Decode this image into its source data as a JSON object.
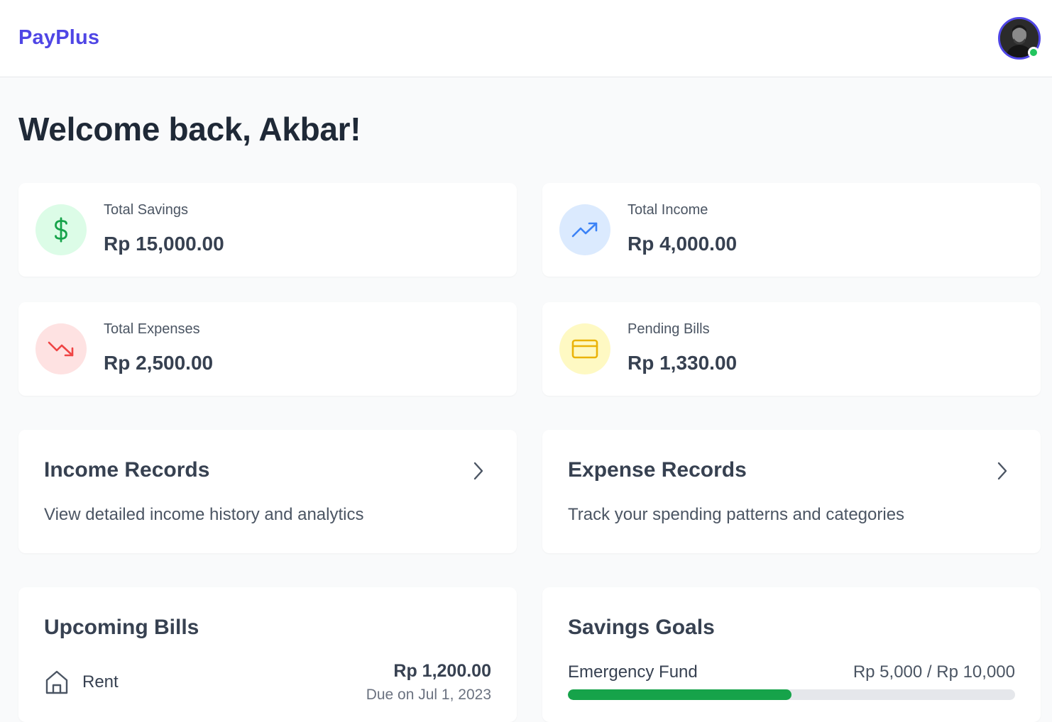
{
  "header": {
    "brand": "PayPlus",
    "user_status": "online"
  },
  "welcome": "Welcome back, Akbar!",
  "stats": [
    {
      "label": "Total Savings",
      "value": "Rp 15,000.00",
      "icon": "dollar-icon",
      "color": "#16a34a",
      "bg": "#dcfce7"
    },
    {
      "label": "Total Income",
      "value": "Rp 4,000.00",
      "icon": "trending-up-icon",
      "color": "#3b82f6",
      "bg": "#dbeafe"
    },
    {
      "label": "Total Expenses",
      "value": "Rp 2,500.00",
      "icon": "trending-down-icon",
      "color": "#ef4444",
      "bg": "#fee2e2"
    },
    {
      "label": "Pending Bills",
      "value": "Rp 1,330.00",
      "icon": "credit-card-icon",
      "color": "#eab308",
      "bg": "#fef9c3"
    }
  ],
  "records": [
    {
      "title": "Income Records",
      "description": "View detailed income history and analytics",
      "icon": "chevron-right-icon"
    },
    {
      "title": "Expense Records",
      "description": "Track your spending patterns and categories",
      "icon": "chevron-right-icon"
    }
  ],
  "upcoming_bills": {
    "title": "Upcoming Bills",
    "items": [
      {
        "name": "Rent",
        "amount": "Rp 1,200.00",
        "due": "Due on Jul 1, 2023",
        "icon": "home-icon"
      }
    ]
  },
  "savings_goals": {
    "title": "Savings Goals",
    "items": [
      {
        "name": "Emergency Fund",
        "values": "Rp 5,000 / Rp 10,000",
        "progress": 0.5,
        "color": "#16a34a"
      }
    ]
  }
}
